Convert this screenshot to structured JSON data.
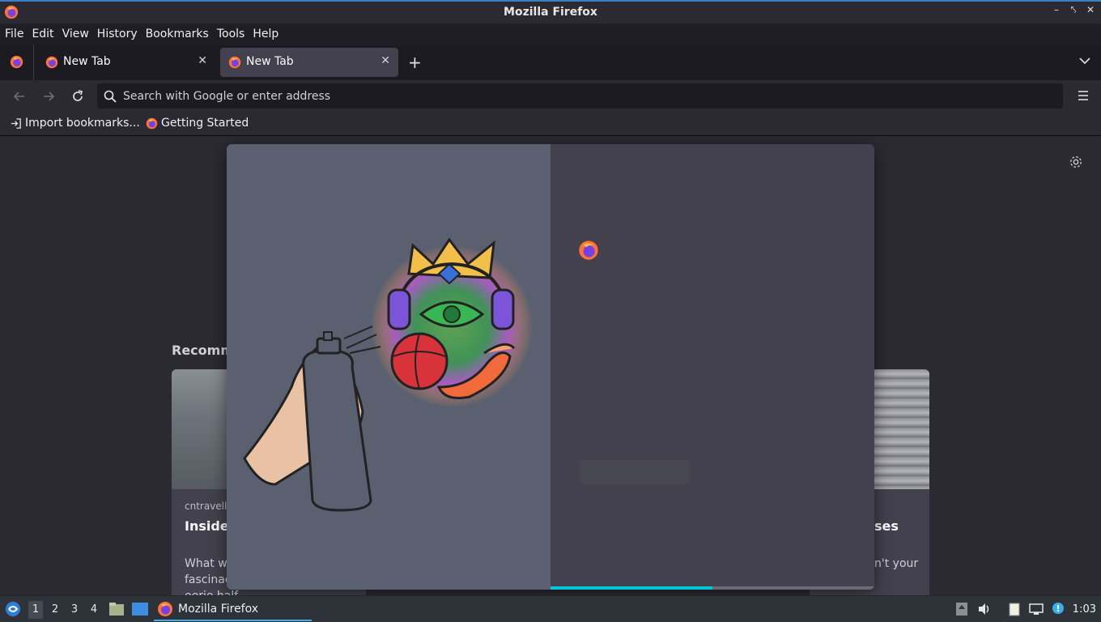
{
  "window": {
    "title": "Mozilla Firefox"
  },
  "menu": {
    "items": [
      "File",
      "Edit",
      "View",
      "History",
      "Bookmarks",
      "Tools",
      "Help"
    ]
  },
  "tabs": [
    {
      "label": "New Tab",
      "active": false
    },
    {
      "label": "New Tab",
      "active": true
    }
  ],
  "urlbar": {
    "placeholder": "Search with Google or enter address",
    "value": ""
  },
  "bookmarks": [
    {
      "label": "Import bookmarks...",
      "icon": "import-icon"
    },
    {
      "label": "Getting Started",
      "icon": "firefox-icon"
    }
  ],
  "newtab": {
    "recommended_heading": "Recomm",
    "cards": [
      {
        "source": "cntravell",
        "title": "Inside town c",
        "description": "What wa urban de",
        "overflow_text": "fascinacy has become an eerie half"
      },
      {
        "title_tail": "ses",
        "desc_tail": "n't your"
      }
    ]
  },
  "onboarding": {
    "progress": 0.5,
    "accent": "#00c8d7"
  },
  "taskbar": {
    "workspaces": [
      "1",
      "2",
      "3",
      "4"
    ],
    "active_workspace": "1",
    "app_label": "Mozilla Firefox",
    "clock": "1:03"
  },
  "colors": {
    "accent_blue": "#3daee9",
    "tab_active": "#42414d",
    "titlebar_border": "#3b7fc4"
  }
}
